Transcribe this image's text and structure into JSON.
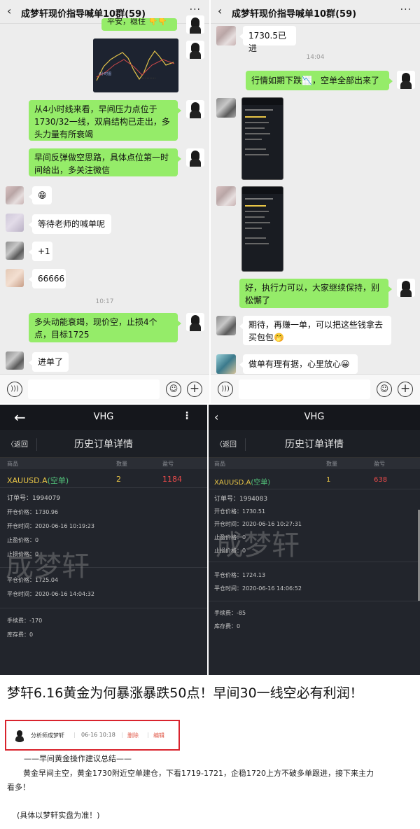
{
  "chat_left": {
    "title": "成梦轩现价指导喊单10群(59)",
    "back_icon": "chevron-left-icon",
    "more_icon": "more-dots-icon",
    "messages": [
      {
        "text": "平安，稳住 👇👇"
      },
      {
        "text": "从4小时线来看，早间压力点位于1730/32一线，双肩结构已走出，多头力量有所衰竭"
      },
      {
        "text": "早间反弹做空思路，具体点位第一时间给出，多关注微信"
      },
      {
        "text": "😁"
      },
      {
        "text": "等待老师的喊单呢"
      },
      {
        "text": "+1"
      },
      {
        "text": "66666"
      },
      {
        "text": "10:17"
      },
      {
        "text": "多头动能衰竭，现价空，止损4个点，目标1725"
      },
      {
        "text": "进单了"
      }
    ]
  },
  "chat_right": {
    "title": "成梦轩现价指导喊单10群(59)",
    "messages": [
      {
        "text": "1730.5已进"
      },
      {
        "text": "14:04"
      },
      {
        "text": "行情如期下跌📉，空单全部出来了"
      },
      {
        "text": "好，执行力可以，大家继续保持，别松懈了"
      },
      {
        "text": "期待，再赚一单，可以把这些钱拿去买包包🤭"
      },
      {
        "text": "做单有理有据，心里放心😀"
      }
    ]
  },
  "trade_left": {
    "app_title": "VHG",
    "back_label": "〈返回",
    "page_title": "历史订单详情",
    "col_product": "商品",
    "col_qty": "数量",
    "col_pnl": "盈亏",
    "symbol": "XAUUSD.A",
    "direction": "(空单)",
    "qty": "2",
    "pnl": "1184",
    "order_no": "订单号：1994079",
    "open_price": "开仓价格：1730.96",
    "open_time": "开仓时间：2020-06-16 10:19:23",
    "stop_loss": "止盈价格：0",
    "take_profit": "止损价格：0",
    "close_price": "平仓价格：1725.04",
    "close_time": "平仓时间：2020-06-16 14:04:32",
    "fee": "手续费：-170",
    "swap": "库存费：0",
    "watermark": "成梦轩"
  },
  "trade_right": {
    "app_title": "VHG",
    "back_label": "〈返回",
    "page_title": "历史订单详情",
    "col_product": "商品",
    "col_qty": "数量",
    "col_pnl": "盈亏",
    "symbol": "XAUUSD.A",
    "direction": "(空单)",
    "qty": "1",
    "pnl": "638",
    "order_no": "订单号：1994083",
    "open_price": "开仓价格：1730.51",
    "open_time": "开仓时间：2020-06-16 10:27:31",
    "stop_loss": "止盈价格：0",
    "take_profit": "止损价格：0",
    "close_price": "平仓价格：1724.13",
    "close_time": "平仓时间：2020-06-16 14:06:52",
    "fee": "手续费：-85",
    "swap": "库存费：0",
    "watermark": "成梦轩"
  },
  "article": {
    "title": "梦轩6.16黄金为何暴涨暴跌50点！早间30一线空必有利润！",
    "author": "分析师成梦轩",
    "time": "06-16 10:18",
    "delete": "删除",
    "edit": "编辑",
    "subtitle": "——早间黄金操作建议总结——",
    "body": "黄金早间主空，黄金1730附近空单建仓，下看1719-1721，企稳1720上方不破多单跟进，接下来主力看多！",
    "footer": "(具体以梦轩实盘为准！)"
  },
  "colors": {
    "wechat_green": "#95ec69",
    "chat_bg": "#ededed",
    "trade_bg": "#22252c",
    "symbol_yellow": "#e8c547",
    "pnl_red": "#e84a4a",
    "highlight_red": "#d9232d"
  }
}
